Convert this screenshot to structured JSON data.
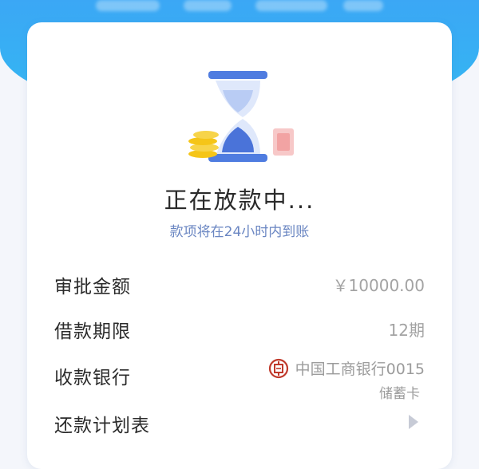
{
  "status": {
    "title": "正在放款中...",
    "subtitle": "款项将在24小时内到账"
  },
  "details": {
    "amount": {
      "label": "审批金额",
      "value": "￥10000.00"
    },
    "term": {
      "label": "借款期限",
      "value": "12期"
    },
    "bank": {
      "label": "收款银行",
      "name": "中国工商银行0015",
      "card_type": "储蓄卡",
      "logo_icon": "icbc-logo-icon"
    },
    "plan": {
      "label": "还款计划表",
      "action_icon": "triangle-right-icon"
    }
  },
  "colors": {
    "header_blue": "#3ba7f5",
    "subtitle_blue": "#6a86c2",
    "hourglass_blue": "#4a73d9",
    "coin_gold": "#f5c518",
    "bank_red": "#c0392b"
  }
}
